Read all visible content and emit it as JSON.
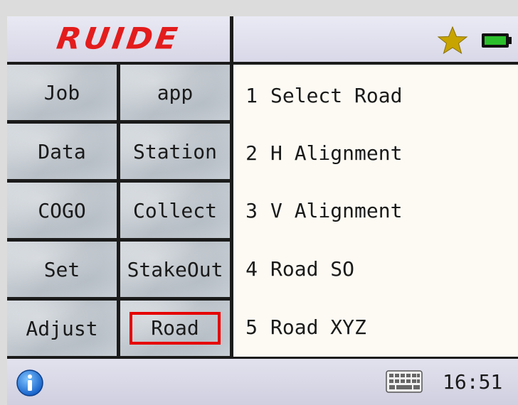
{
  "header": {
    "logo": "RUIDE",
    "star_icon": "star-icon",
    "battery_icon": "battery-icon"
  },
  "menu": {
    "items": [
      {
        "label": "Job"
      },
      {
        "label": "app"
      },
      {
        "label": "Data"
      },
      {
        "label": "Station"
      },
      {
        "label": "COGO"
      },
      {
        "label": "Collect"
      },
      {
        "label": "Set"
      },
      {
        "label": "StakeOut"
      },
      {
        "label": "Adjust"
      },
      {
        "label": "Road",
        "selected": true
      }
    ]
  },
  "road_menu": {
    "items": [
      {
        "num": "1",
        "label": "Select Road"
      },
      {
        "num": "2",
        "label": "H Alignment"
      },
      {
        "num": "3",
        "label": "V Alignment"
      },
      {
        "num": "4",
        "label": "Road SO"
      },
      {
        "num": "5",
        "label": "Road XYZ"
      }
    ]
  },
  "status": {
    "info_icon": "info-icon",
    "keyboard_icon": "keyboard-icon",
    "time": "16:51"
  },
  "colors": {
    "logo": "#e31c1c",
    "selection_border": "#e60000",
    "star": "#c8a400",
    "battery": "#22aa22"
  }
}
